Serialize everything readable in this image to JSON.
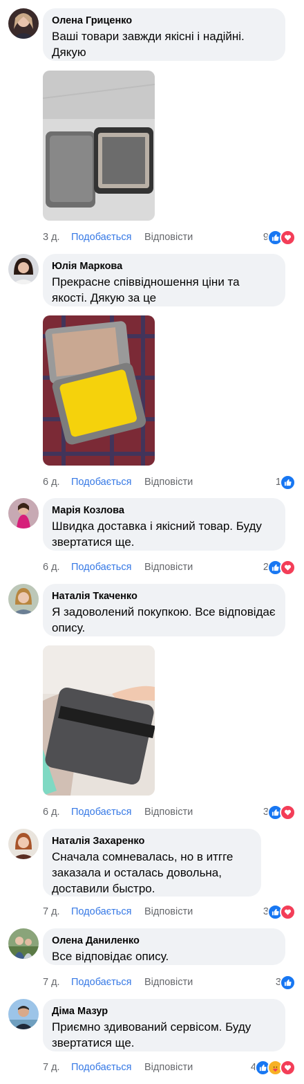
{
  "labels": {
    "like": "Подобається",
    "reply": "Відповісти"
  },
  "colors": {
    "like_link": "#3578e5",
    "meta": "#65676b",
    "bubble": "#f0f2f5",
    "like_reaction": "#1877f2",
    "love_reaction": "#f33e58",
    "care_reaction": "#f7b125"
  },
  "comments": [
    {
      "author": "Олена Гриценко",
      "text": "Ваші товари завжди якісні і надійні. Дякую",
      "time": "3 д.",
      "reaction_count": "9",
      "reactions": [
        "like-icon",
        "love-icon"
      ],
      "photo": "open grey lunch bag with container"
    },
    {
      "author": "Юлія Маркова",
      "text": "Прекрасне співвідношення ціни та якості. Дякую за це",
      "time": "6 д.",
      "reaction_count": "1",
      "reactions": [
        "like-icon"
      ],
      "photo": "lunch bag with yellow ice pack on plaid"
    },
    {
      "author": "Марія Козлова",
      "text": "Швидка доставка і якісний товар. Буду звертатися ще.",
      "time": "6 д.",
      "reaction_count": "2",
      "reactions": [
        "like-icon",
        "love-icon"
      ]
    },
    {
      "author": "Наталія Ткаченко",
      "text": "Я задоволений покупкою. Все відповідає опису.",
      "time": "6 д.",
      "reaction_count": "3",
      "reactions": [
        "like-icon",
        "love-icon"
      ],
      "photo": "hand holding grey lunch bag"
    },
    {
      "author": "Наталія Захаренко",
      "text": "Сначала сомневалась, но в итгге заказала и осталась довольна, доставили быстро.",
      "time": "7 д.",
      "reaction_count": "3",
      "reactions": [
        "like-icon",
        "love-icon"
      ]
    },
    {
      "author": "Олена Даниленко",
      "text": "Все відповідає опису.",
      "time": "7 д.",
      "reaction_count": "3",
      "reactions": [
        "like-icon"
      ]
    },
    {
      "author": "Діма Мазур",
      "text": "Приємно здивований сервісом. Буду звертатися ще.",
      "time": "7 д.",
      "reaction_count": "4",
      "reactions": [
        "like-icon",
        "care-icon",
        "love-icon"
      ]
    }
  ]
}
